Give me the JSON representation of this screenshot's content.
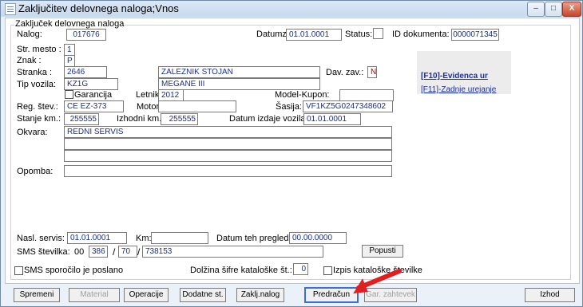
{
  "window": {
    "title": "Zaključitev delovnega naloga;Vnos"
  },
  "group": {
    "title": "Zaključek delovnega naloga"
  },
  "labels": {
    "nalog": "Nalog:",
    "datumz": "Datumz:",
    "status": "Status:",
    "id_dokumenta": "ID dokumenta:",
    "str_mesto": "Str. mesto :",
    "znak": "Znak :",
    "stranka": "Stranka :",
    "dav_zav": "Dav. zav.:",
    "tip_vozila": "Tip vozila:",
    "garancija": "Garancija",
    "letnik": "Letnik:",
    "model_kupon": "Model-Kupon:",
    "reg_stev": "Reg. štev.:",
    "motor": "Motor:",
    "sasija": "Šasija:",
    "stanje_km": "Stanje km.:",
    "izhodni_km": "Izhodni km.:",
    "datum_izdaje": "Datum izdaje vozila:",
    "okvara": "Okvara:",
    "opomba": "Opomba:",
    "nasl_servis": "Nasl. servis:",
    "km": "Km:",
    "datum_teh": "Datum teh pregleda:",
    "sms_stevilka": "SMS številka:",
    "sms_poslano": "SMS sporočilo je poslano",
    "dolzina": "Dolžina šifre kataloške št.:",
    "izpis": "Izpis kataloške številke",
    "slash1": "/",
    "slash2": "/"
  },
  "fields": {
    "nalog": "017676",
    "datumz": "01.01.0001",
    "status": "",
    "id_dokumenta": "0000071345",
    "str_mesto": "1",
    "znak": "P",
    "stranka_code": "2646",
    "stranka_name": "ZALEZNIK STOJAN",
    "dav_zav": "N",
    "tip_vozila": "KZ1G",
    "tip_vozila_name": "MEGANE III",
    "letnik": "2012",
    "model_kupon": "",
    "reg_stev": "CE EZ-373",
    "motor": "",
    "sasija": "VF1KZ5G0247348602",
    "stanje_km": "255555",
    "izhodni_km": "255555",
    "datum_izdaje": "01.01.0001",
    "okvara1": "REDNI SERVIS",
    "okvara2": "",
    "okvara3": "",
    "opomba": "",
    "nasl_servis": "01.01.0001",
    "km": "",
    "datum_teh": "00.00.0000",
    "sms_prefix": "00",
    "sms_code": "386",
    "sms_area": "70",
    "sms_number": "738153",
    "dolzina": "0"
  },
  "links": {
    "f10": "[F10]-Evidenca ur",
    "f11": "[F11]-Zadnje urejanje"
  },
  "buttons": {
    "popusti": "Popusti",
    "spremeni": "Spremeni",
    "material": "Material",
    "operacije": "Operacije",
    "dodatne": "Dodatne st.",
    "zaklj": "Zaklj.nalog",
    "predracun": "Predračun",
    "gar_zahtevek": "Gar. zahtevek",
    "izhod": "Izhod"
  },
  "titlebar_buttons": {
    "minimize": "–",
    "maximize": "□",
    "close": "X"
  },
  "colors": {
    "field_text": "#1d2e8c",
    "link": "#1a2fb0",
    "arrow": "#e02020",
    "highlight": "#3a6fd8"
  }
}
